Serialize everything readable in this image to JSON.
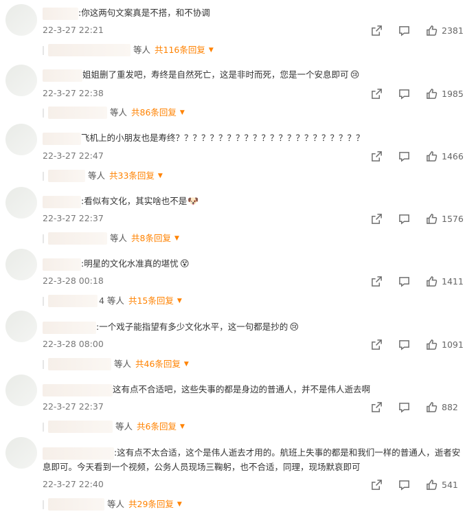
{
  "comments": [
    {
      "text": ":你这两句文案真是不搭，和不协调",
      "time": "22-3-27 22:21",
      "likes": "2381",
      "reply_label": "等人",
      "reply_count": "共116条回复",
      "emoji": ""
    },
    {
      "text": "姐姐删了重发吧，寿终是自然死亡，这是非时而死，您是一个安息即可",
      "time": "22-3-27 22:38",
      "likes": "1985",
      "reply_label": "等人",
      "reply_count": "共86条回复",
      "emoji": "😢"
    },
    {
      "text": "飞机上的小朋友也是寿终？？？？？？？？？？？？？？？？？？？？？？",
      "time": "22-3-27 22:47",
      "likes": "1466",
      "reply_label": "等人",
      "reply_count": "共33条回复",
      "emoji": ""
    },
    {
      "text": ":看似有文化，其实啥也不是",
      "time": "22-3-27 22:37",
      "likes": "1576",
      "reply_label": "等人",
      "reply_count": "共8条回复",
      "emoji": "🐶"
    },
    {
      "text": ":明星的文化水准真的堪忧",
      "time": "22-3-28 00:18",
      "likes": "1411",
      "reply_label": "4 等人",
      "reply_count": "共15条回复",
      "emoji": "😵"
    },
    {
      "text": ":一个戏子能指望有多少文化水平，这一句都是抄的",
      "time": "22-3-28 08:00",
      "likes": "1091",
      "reply_label": "等人",
      "reply_count": "共46条回复",
      "emoji": "😢"
    },
    {
      "text": "这有点不合适吧，这些失事的都是身边的普通人，并不是伟人逝去啊",
      "time": "22-3-27 22:37",
      "likes": "882",
      "reply_label": "等人",
      "reply_count": "共6条回复",
      "emoji": ""
    },
    {
      "text": ":这有点不太合适，这个是伟人逝去才用的。航班上失事的都是和我们一样的普通人，逝者安息即可。今天看到一个视频，公务人员现场三鞠躬，也不合适，同理，现场默哀即可",
      "time": "22-3-27 22:40",
      "likes": "541",
      "reply_label": "等人",
      "reply_count": "共29条回复",
      "emoji": ""
    }
  ]
}
